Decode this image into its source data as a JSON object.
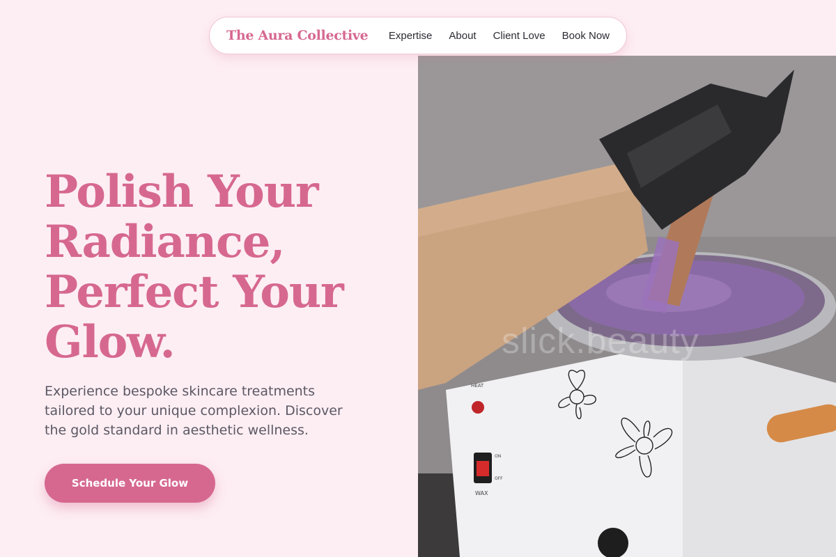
{
  "nav": {
    "brand": "The Aura Collective",
    "links": [
      "Expertise",
      "About",
      "Client Love",
      "Book Now"
    ]
  },
  "hero": {
    "headline": [
      "Polish Your",
      "Radiance,",
      "Perfect Your",
      "Glow."
    ],
    "subtext": "Experience bespoke skincare treatments tailored to your unique complexion. Discover the gold standard in aesthetic wellness.",
    "cta_label": "Schedule Your Glow"
  },
  "image": {
    "description_icon": "wax-warmer-photo",
    "watermark": "slick.beauty",
    "device_labels": {
      "heat": "HEAT",
      "on": "ON",
      "off": "OFF",
      "wax": "WAX"
    }
  },
  "colors": {
    "accent": "#d6688f",
    "background": "#fdeef3",
    "text_dark": "#2b2b33",
    "text_muted": "#5b5864"
  }
}
